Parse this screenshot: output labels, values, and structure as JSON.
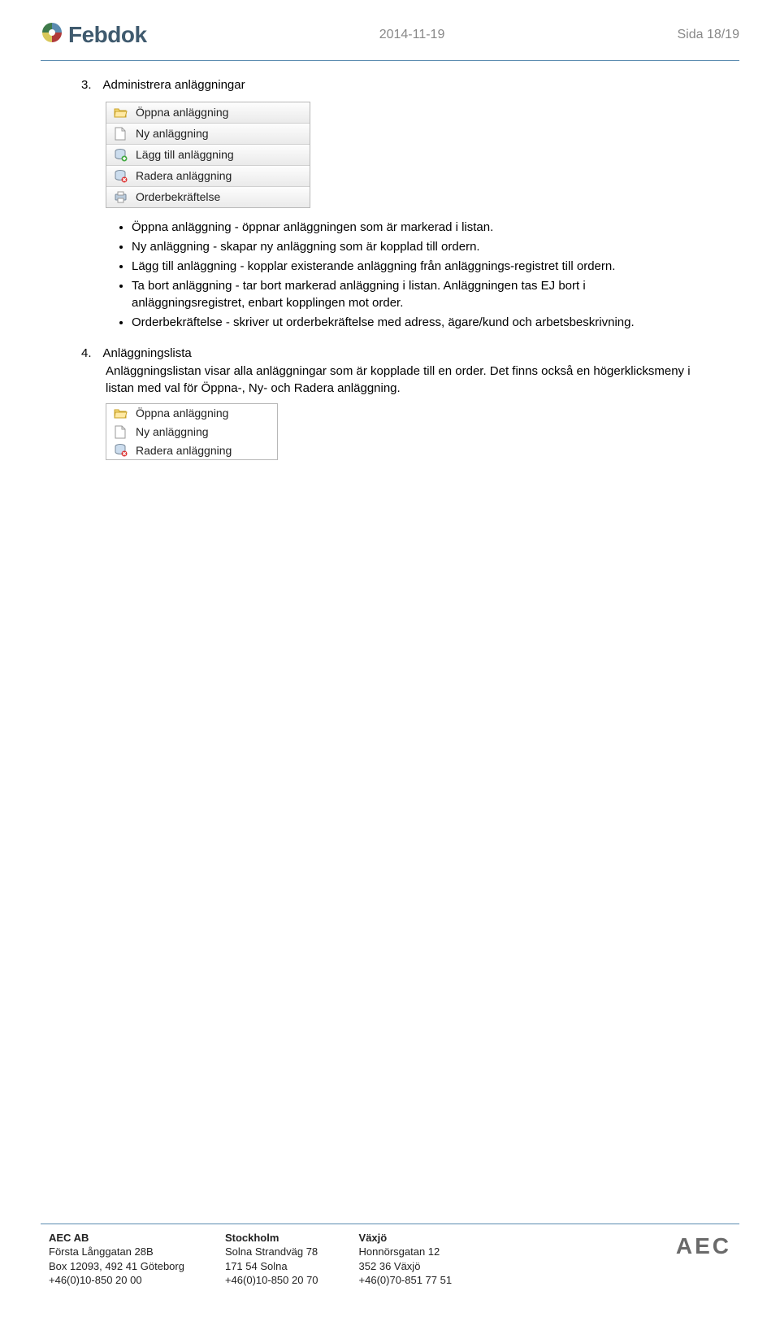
{
  "header": {
    "brand": "Febdok",
    "date": "2014-11-19",
    "page": "Sida 18/19"
  },
  "section3": {
    "num": "3.",
    "title": "Administrera anläggningar",
    "toolbar": [
      "Öppna anläggning",
      "Ny anläggning",
      "Lägg till anläggning",
      "Radera anläggning",
      "Orderbekräftelse"
    ],
    "bullets": [
      "Öppna anläggning - öppnar anläggningen som är markerad i listan.",
      "Ny anläggning - skapar ny anläggning som är kopplad till ordern.",
      "Lägg till anläggning - kopplar existerande anläggning från anläggnings-registret till ordern.",
      "Ta bort anläggning - tar bort markerad anläggning i listan. Anläggningen tas EJ bort i anläggningsregistret, enbart kopplingen mot order.",
      "Orderbekräftelse - skriver ut orderbekräftelse med adress, ägare/kund och arbetsbeskrivning."
    ]
  },
  "section4": {
    "num": "4.",
    "title": "Anläggningslista",
    "body": "Anläggningslistan visar alla anläggningar som är kopplade till en order. Det finns också en högerklicksmeny i listan med val för Öppna-, Ny- och Radera anläggning.",
    "context": [
      "Öppna anläggning",
      "Ny anläggning",
      "Radera anläggning"
    ]
  },
  "footer": {
    "col1": {
      "name": "AEC AB",
      "l1": "Första Långgatan 28B",
      "l2": "Box 12093, 492 41 Göteborg",
      "l3": "+46(0)10-850 20 00"
    },
    "col2": {
      "name": "Stockholm",
      "l1": "Solna Strandväg 78",
      "l2": "171 54 Solna",
      "l3": "+46(0)10-850 20 70"
    },
    "col3": {
      "name": "Växjö",
      "l1": "Honnörsgatan 12",
      "l2": "352 36 Växjö",
      "l3": "+46(0)70-851 77 51"
    },
    "logo": "AEC"
  }
}
